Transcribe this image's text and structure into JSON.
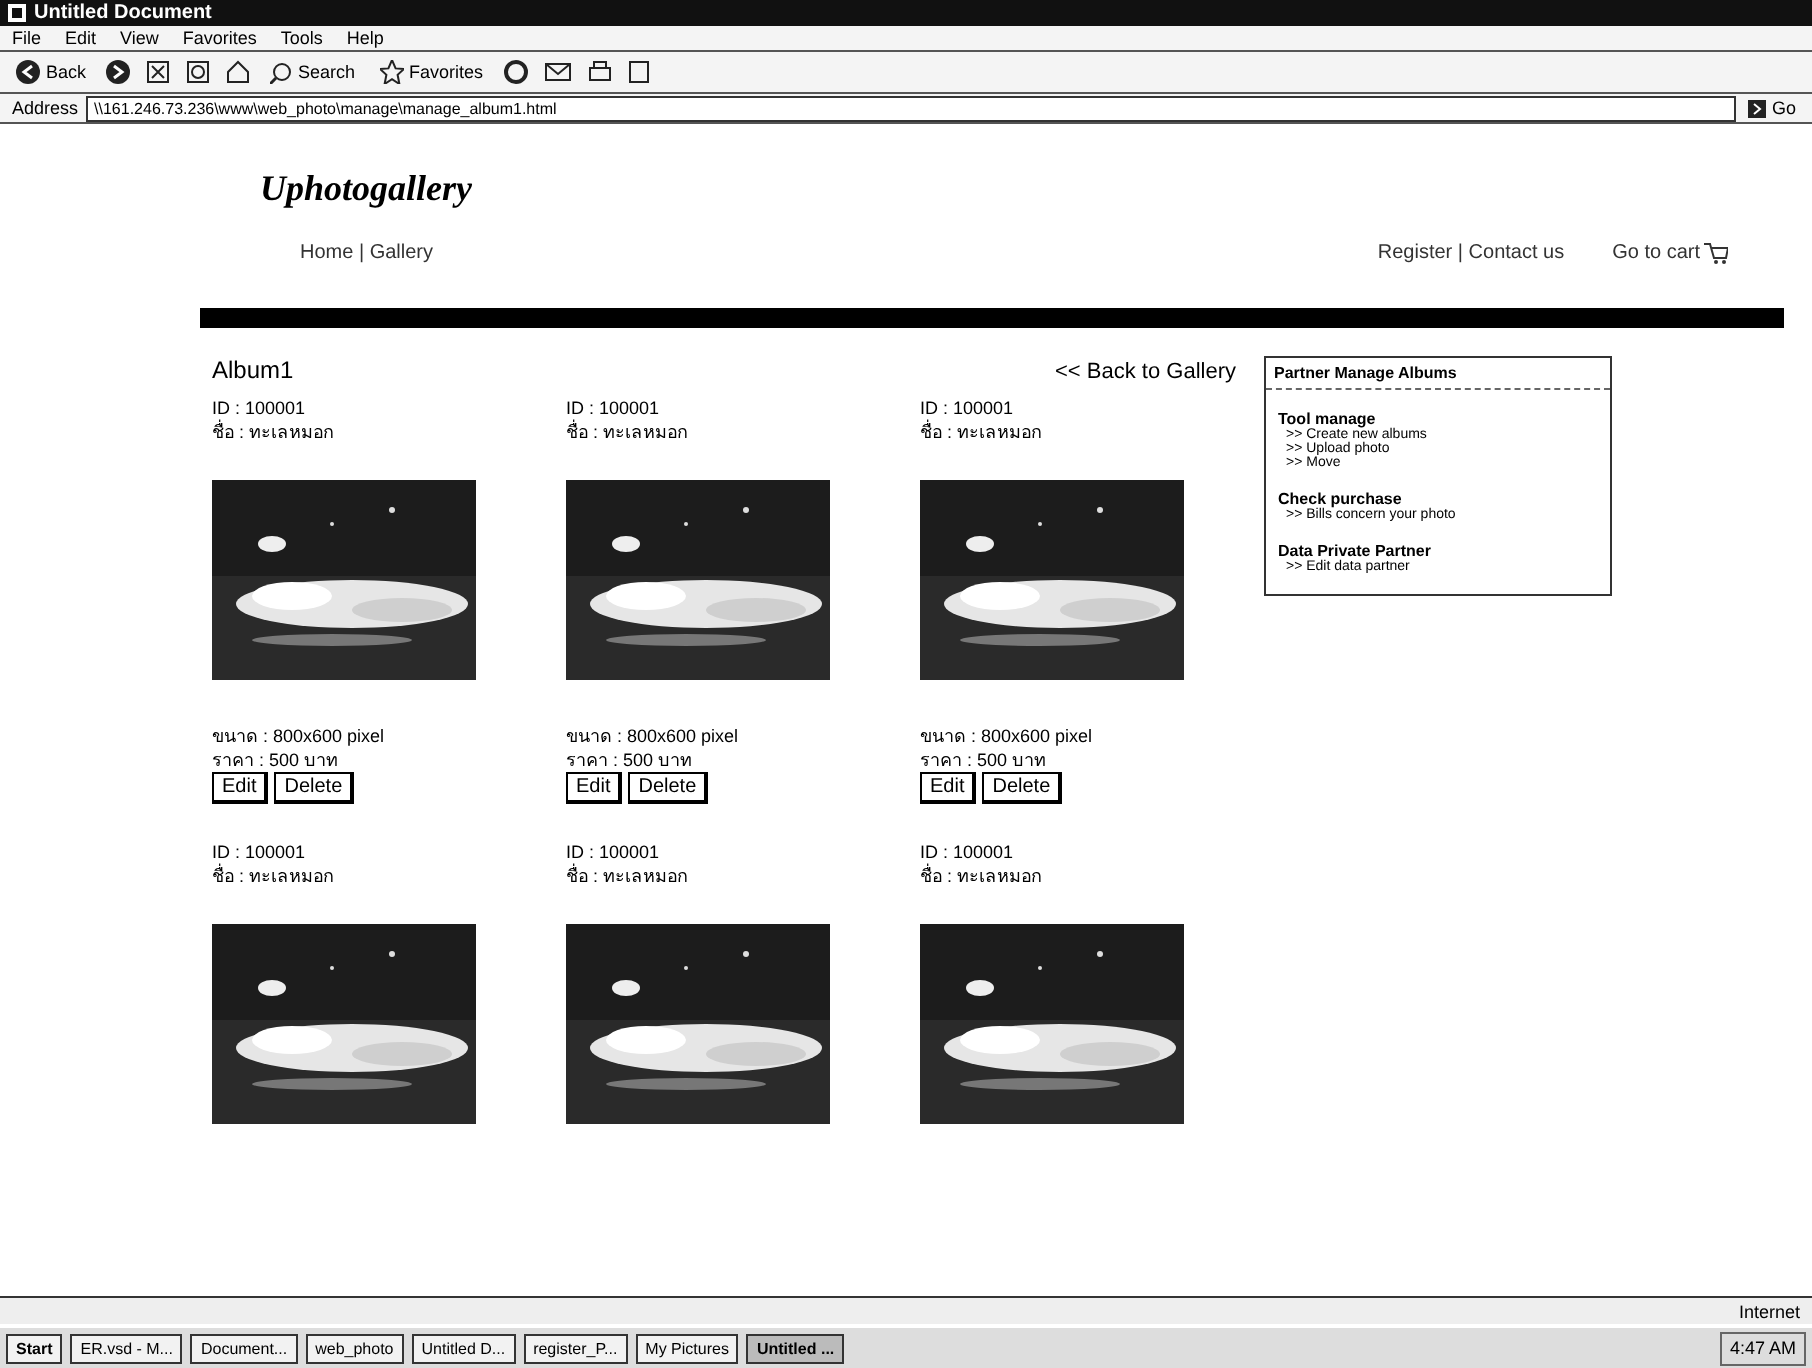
{
  "window": {
    "title": "Untitled Document"
  },
  "menu": [
    "File",
    "Edit",
    "View",
    "Favorites",
    "Tools",
    "Help"
  ],
  "toolbar": {
    "back": "Back",
    "search": "Search",
    "favorites": "Favorites"
  },
  "address": {
    "label": "Address",
    "value": "\\\\161.246.73.236\\www\\web_photo\\manage\\manage_album1.html",
    "go": "Go"
  },
  "site": {
    "logo": "Uphotogallery",
    "nav_left": "Home | Gallery",
    "nav_right": "Register | Contact us",
    "cart": "Go to cart"
  },
  "album": {
    "title": "Album1",
    "back_link": "<< Back to Gallery"
  },
  "photos": [
    {
      "id": "ID : 100001",
      "name": "ชื่อ : ทะเลหมอก",
      "size": "ขนาด : 800x600 pixel",
      "price": "ราคา : 500 บาท",
      "actions": [
        "Edit",
        "Delete"
      ]
    },
    {
      "id": "ID : 100001",
      "name": "ชื่อ : ทะเลหมอก",
      "size": "ขนาด : 800x600 pixel",
      "price": "ราคา : 500 บาท",
      "actions": [
        "Edit",
        "Delete"
      ]
    },
    {
      "id": "ID : 100001",
      "name": "ชื่อ : ทะเลหมอก",
      "size": "ขนาด : 800x600 pixel",
      "price": "ราคา : 500 บาท",
      "actions": [
        "Edit",
        "Delete"
      ]
    },
    {
      "id": "ID : 100001",
      "name": "ชื่อ : ทะเลหมอก"
    },
    {
      "id": "ID : 100001",
      "name": "ชื่อ : ทะเลหมอก"
    },
    {
      "id": "ID : 100001",
      "name": "ชื่อ : ทะเลหมอก"
    }
  ],
  "sidebar": {
    "title": "Partner Manage Albums",
    "sections": [
      {
        "heading": "Tool manage",
        "links": [
          ">> Create new albums",
          ">> Upload photo",
          ">> Move"
        ]
      },
      {
        "heading": "Check purchase",
        "links": [
          ">> Bills concern your photo"
        ]
      },
      {
        "heading": "Data Private Partner",
        "links": [
          ">> Edit data partner"
        ]
      }
    ]
  },
  "status_bar": {
    "zone": "Internet"
  },
  "taskbar": {
    "start": "Start",
    "tasks": [
      {
        "label": "ER.vsd - M...",
        "selected": false
      },
      {
        "label": "Document...",
        "selected": false
      },
      {
        "label": "web_photo",
        "selected": false
      },
      {
        "label": "Untitled D...",
        "selected": false
      },
      {
        "label": "register_P...",
        "selected": false
      },
      {
        "label": "My Pictures",
        "selected": false
      },
      {
        "label": "Untitled ...",
        "selected": true
      }
    ],
    "clock": "4:47 AM"
  }
}
